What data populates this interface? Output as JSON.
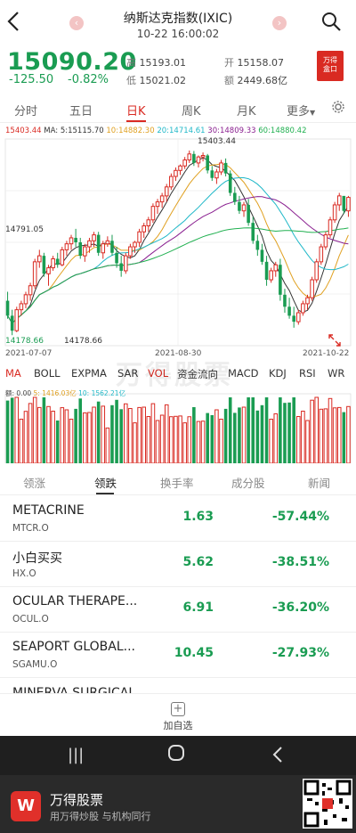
{
  "header": {
    "back_icon": "back-arrow-icon",
    "title": "纳斯达克指数(IXIC)",
    "subtitle": "10-22 16:00:02",
    "prev_icon": "chevron-left-circle-icon",
    "next_icon": "chevron-right-circle-icon",
    "search_icon": "search-icon"
  },
  "quote": {
    "price": "15090.20",
    "change": "-125.50",
    "change_pct": "-0.82%",
    "high_label": "高",
    "high": "15193.01",
    "low_label": "低",
    "low": "15021.02",
    "open_label": "开",
    "open": "15158.07",
    "amount_label": "额",
    "amount": "2449.68亿",
    "brand_line1": "万得",
    "brand_line2": "盒口",
    "color_down": "#1a9c52",
    "color_up": "#d92a22"
  },
  "period_tabs": [
    "分时",
    "五日",
    "日K",
    "周K",
    "月K",
    "更多"
  ],
  "period_active": "日K",
  "settings_icon": "gear-icon",
  "ma_legend": {
    "current": "15403.44",
    "ma_label": "MA:",
    "ma5": "5:15115.70",
    "ma10": "10:14882.30",
    "ma20": "20:14714.61",
    "ma30": "30:14809.33",
    "ma60": "60:14880.42"
  },
  "chart_data": {
    "type": "candlestick",
    "y_axis_labels": [
      "15403.44",
      "14791.05",
      "14178.66"
    ],
    "max_label": "15403.44",
    "min_label": "14178.66",
    "x_dates": [
      "2021-07-07",
      "2021-08-30",
      "2021-10-22"
    ],
    "ma_colors": {
      "ma5": "#333333",
      "ma10": "#e0a020",
      "ma20": "#20b8c8",
      "ma30": "#8a2090",
      "ma60": "#20b050"
    },
    "watermark": "万得股票",
    "ohlc": [
      [
        14400,
        14460,
        14280,
        14300
      ],
      [
        14300,
        14340,
        14170,
        14200
      ],
      [
        14200,
        14360,
        14190,
        14340
      ],
      [
        14340,
        14400,
        14300,
        14380
      ],
      [
        14380,
        14460,
        14350,
        14440
      ],
      [
        14440,
        14520,
        14400,
        14500
      ],
      [
        14500,
        14680,
        14480,
        14660
      ],
      [
        14660,
        14740,
        14620,
        14700
      ],
      [
        14700,
        14720,
        14560,
        14580
      ],
      [
        14580,
        14640,
        14500,
        14620
      ],
      [
        14620,
        14700,
        14600,
        14680
      ],
      [
        14680,
        14720,
        14620,
        14640
      ],
      [
        14640,
        14760,
        14630,
        14740
      ],
      [
        14740,
        14800,
        14700,
        14780
      ],
      [
        14780,
        14840,
        14740,
        14820
      ],
      [
        14820,
        14880,
        14760,
        14790
      ],
      [
        14790,
        14820,
        14680,
        14700
      ],
      [
        14700,
        14780,
        14660,
        14760
      ],
      [
        14760,
        14820,
        14720,
        14800
      ],
      [
        14800,
        14860,
        14760,
        14840
      ],
      [
        14840,
        14860,
        14700,
        14720
      ],
      [
        14720,
        14800,
        14680,
        14780
      ],
      [
        14780,
        14830,
        14760,
        14800
      ],
      [
        14800,
        14840,
        14700,
        14720
      ],
      [
        14720,
        14760,
        14620,
        14650
      ],
      [
        14650,
        14700,
        14560,
        14600
      ],
      [
        14600,
        14720,
        14580,
        14700
      ],
      [
        14700,
        14780,
        14680,
        14760
      ],
      [
        14760,
        14800,
        14720,
        14790
      ],
      [
        14790,
        14880,
        14760,
        14860
      ],
      [
        14860,
        14920,
        14820,
        14900
      ],
      [
        14900,
        14960,
        14860,
        14940
      ],
      [
        14940,
        15050,
        14920,
        15030
      ],
      [
        15030,
        15080,
        14980,
        15060
      ],
      [
        15060,
        15120,
        15020,
        15100
      ],
      [
        15100,
        15180,
        15060,
        15160
      ],
      [
        15160,
        15250,
        15140,
        15230
      ],
      [
        15230,
        15290,
        15200,
        15270
      ],
      [
        15270,
        15310,
        15240,
        15300
      ],
      [
        15300,
        15360,
        15280,
        15340
      ],
      [
        15340,
        15403,
        15320,
        15380
      ],
      [
        15380,
        15400,
        15300,
        15320
      ],
      [
        15320,
        15370,
        15290,
        15360
      ],
      [
        15360,
        15390,
        15330,
        15370
      ],
      [
        15370,
        15380,
        15250,
        15270
      ],
      [
        15270,
        15300,
        15200,
        15220
      ],
      [
        15220,
        15280,
        15180,
        15260
      ],
      [
        15260,
        15340,
        15240,
        15320
      ],
      [
        15320,
        15350,
        15230,
        15250
      ],
      [
        15250,
        15270,
        15100,
        15120
      ],
      [
        15120,
        15160,
        15040,
        15060
      ],
      [
        15060,
        15100,
        14980,
        15000
      ],
      [
        15000,
        15060,
        14960,
        15040
      ],
      [
        15040,
        15080,
        14900,
        14920
      ],
      [
        14920,
        14960,
        14780,
        14800
      ],
      [
        14800,
        14840,
        14700,
        14740
      ],
      [
        14740,
        14780,
        14640,
        14660
      ],
      [
        14660,
        14700,
        14500,
        14540
      ],
      [
        14540,
        14620,
        14520,
        14600
      ],
      [
        14600,
        14660,
        14560,
        14640
      ],
      [
        14640,
        14680,
        14400,
        14440
      ],
      [
        14440,
        14480,
        14320,
        14360
      ],
      [
        14360,
        14420,
        14280,
        14300
      ],
      [
        14300,
        14360,
        14220,
        14260
      ],
      [
        14260,
        14340,
        14240,
        14320
      ],
      [
        14320,
        14400,
        14300,
        14380
      ],
      [
        14380,
        14440,
        14340,
        14420
      ],
      [
        14420,
        14560,
        14400,
        14540
      ],
      [
        14540,
        14680,
        14520,
        14660
      ],
      [
        14660,
        14780,
        14640,
        14760
      ],
      [
        14760,
        14860,
        14740,
        14840
      ],
      [
        14840,
        14960,
        14820,
        14940
      ],
      [
        14940,
        15060,
        14920,
        15040
      ],
      [
        15040,
        15120,
        15000,
        15100
      ],
      [
        15100,
        15060,
        14980,
        15000
      ],
      [
        15000,
        15100,
        14960,
        15090
      ]
    ],
    "volume_ratio_labels": {
      "vol": "额: 0.00",
      "v5": "5: 1416.03亿",
      "v10": "10: 1562.21亿"
    }
  },
  "indicator_tabs": [
    "MA",
    "BOLL",
    "EXPMA",
    "SAR",
    "VOL",
    "资金流向",
    "MACD",
    "KDJ",
    "RSI",
    "WR"
  ],
  "indicator_active_ma": "MA",
  "indicator_active_vol": "VOL",
  "list_tabs": [
    "领涨",
    "领跌",
    "换手率",
    "成分股",
    "新闻"
  ],
  "list_active": "领跌",
  "rows": [
    {
      "name": "METACRINE",
      "code": "MTCR.O",
      "price": "1.63",
      "pct": "-57.44%"
    },
    {
      "name": "小白买买",
      "code": "HX.O",
      "price": "5.62",
      "pct": "-38.51%"
    },
    {
      "name": "OCULAR THERAPE...",
      "code": "OCUL.O",
      "price": "6.91",
      "pct": "-36.20%"
    },
    {
      "name": "SEAPORT GLOBAL...",
      "code": "SGAMU.O",
      "price": "10.45",
      "pct": "-27.93%"
    },
    {
      "name": "MINERVA SURGICAL",
      "code": "",
      "price": "",
      "pct": ""
    }
  ],
  "add_button": {
    "icon": "plus-square-icon",
    "label": "加自选"
  },
  "navbar": {
    "recents_icon": "recents-icon",
    "home_icon": "home-icon",
    "back_icon": "back-icon"
  },
  "banner": {
    "logo_icon": "wind-logo-icon",
    "title": "万得股票",
    "subtitle": "用万得炒股 与机构同行",
    "qr_icon": "qr-code-icon"
  }
}
